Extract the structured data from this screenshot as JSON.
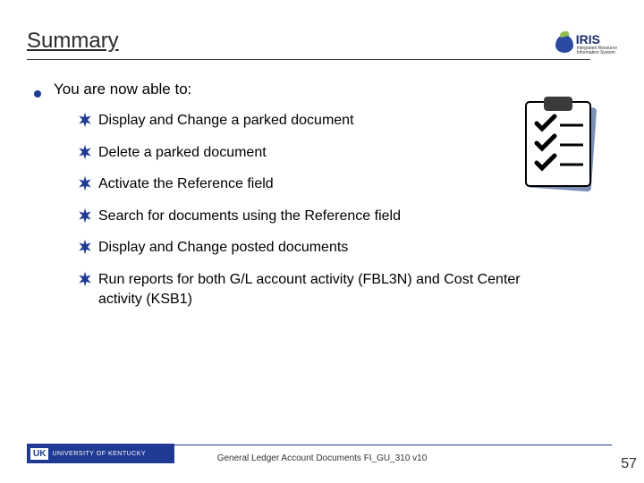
{
  "header": {
    "title": "Summary",
    "logo_text": "IRIS",
    "logo_sub1": "Integrated Resource",
    "logo_sub2": "Information System"
  },
  "intro": "You are now able to:",
  "items": [
    "Display and Change a parked document",
    "Delete a parked document",
    "Activate the Reference field",
    "Search for documents using the Reference field",
    "Display and Change posted documents",
    "Run reports for both G/L account activity (FBL3N) and Cost Center activity (KSB1)"
  ],
  "footer": {
    "uk_mark": "UK",
    "uk_text": "UNIVERSITY OF KENTUCKY",
    "doc_title": "General Ledger Account Documents FI_GU_310 v10",
    "page": "57"
  }
}
